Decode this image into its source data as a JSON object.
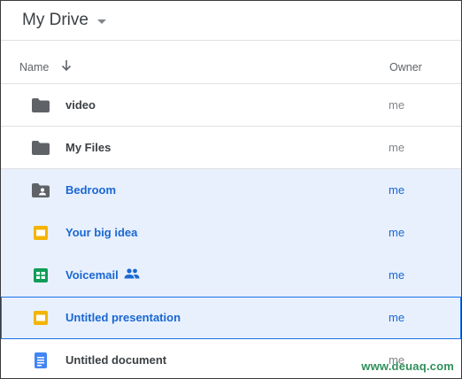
{
  "header": {
    "title": "My Drive"
  },
  "columns": {
    "name": "Name",
    "owner": "Owner"
  },
  "files": [
    {
      "name": "video",
      "owner": "me",
      "icon": "folder-icon",
      "state": "normal"
    },
    {
      "name": "My Files",
      "owner": "me",
      "icon": "folder-icon",
      "state": "normal"
    },
    {
      "name": "Bedroom",
      "owner": "me",
      "icon": "shared-folder-icon",
      "state": "selected"
    },
    {
      "name": "Your big idea",
      "owner": "me",
      "icon": "slides-icon",
      "state": "selected"
    },
    {
      "name": "Voicemail",
      "owner": "me",
      "icon": "sheets-icon",
      "state": "selected",
      "shared": true
    },
    {
      "name": "Untitled presentation",
      "owner": "me",
      "icon": "slides-icon",
      "state": "focused"
    },
    {
      "name": "Untitled document",
      "owner": "me",
      "icon": "docs-icon",
      "state": "normal"
    }
  ],
  "watermark": "www.deuaq.com",
  "colors": {
    "selection_bg": "#e8f0fe",
    "selection_text": "#1967d2",
    "folder": "#5f6368",
    "slides": "#f4b400",
    "sheets": "#0f9d58",
    "docs": "#4285f4"
  }
}
